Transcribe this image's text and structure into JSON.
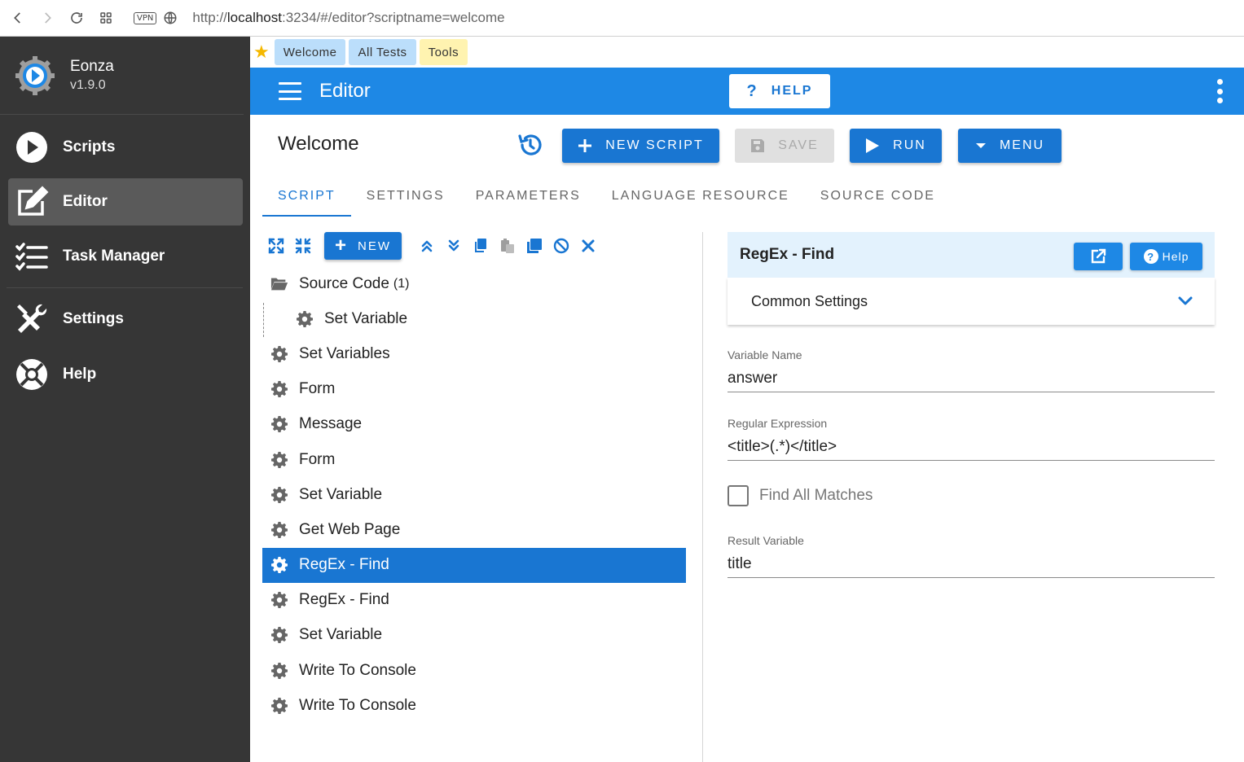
{
  "browser": {
    "url_prefix": "http://",
    "url_host": "localhost",
    "url_rest": ":3234/#/editor?scriptname=welcome",
    "vpn_label": "VPN"
  },
  "sidebar": {
    "brand_name": "Eonza",
    "brand_version": "v1.9.0",
    "items": [
      {
        "label": "Scripts",
        "icon": "play-circle-icon"
      },
      {
        "label": "Editor",
        "icon": "edit-icon",
        "active": true
      },
      {
        "label": "Task Manager",
        "icon": "checklist-icon"
      },
      {
        "label": "Settings",
        "icon": "tools-icon"
      },
      {
        "label": "Help",
        "icon": "lifebuoy-icon"
      }
    ]
  },
  "quick_tabs": [
    {
      "label": "Welcome",
      "color": "#bbdefb"
    },
    {
      "label": "All Tests",
      "color": "#bbdefb"
    },
    {
      "label": "Tools",
      "color": "#fff3b0"
    }
  ],
  "appbar": {
    "title": "Editor",
    "help_label": "HELP",
    "accent": "#1e88e5"
  },
  "editor": {
    "script_title": "Welcome",
    "new_script_label": "NEW SCRIPT",
    "save_label": "SAVE",
    "run_label": "RUN",
    "menu_label": "MENU",
    "tabs": [
      "SCRIPT",
      "SETTINGS",
      "PARAMETERS",
      "LANGUAGE RESOURCE",
      "SOURCE CODE"
    ],
    "active_tab": "SCRIPT",
    "toolbar_new_label": "NEW"
  },
  "tree": {
    "folder_label": "Source Code",
    "folder_count": "(1)",
    "child_label": "Set Variable",
    "items": [
      "Set Variables",
      "Form",
      "Message",
      "Form",
      "Set Variable",
      "Get Web Page",
      "RegEx - Find",
      "RegEx - Find",
      "Set Variable",
      "Write To Console",
      "Write To Console"
    ],
    "selected_index": 6
  },
  "panel": {
    "title": "RegEx - Find",
    "help_label": "Help",
    "common_settings_label": "Common Settings",
    "variable_name_label": "Variable Name",
    "variable_name_value": "answer",
    "regex_label": "Regular Expression",
    "regex_value": "<title>(.*)</title>",
    "find_all_label": "Find All Matches",
    "result_label": "Result Variable",
    "result_value": "title"
  }
}
